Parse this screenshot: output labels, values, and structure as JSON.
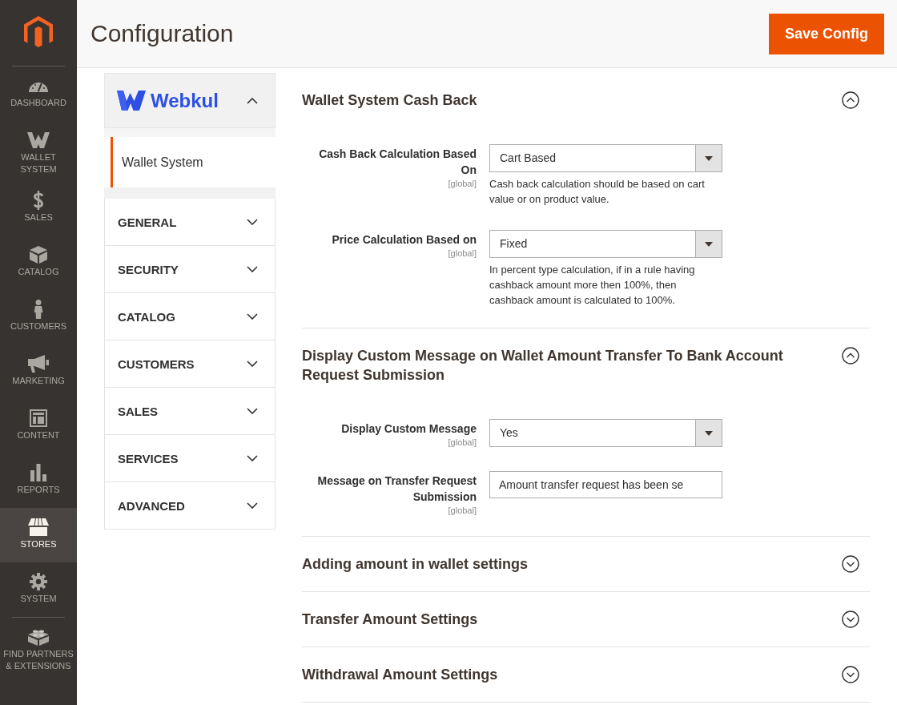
{
  "sidebar": {
    "items": [
      {
        "kind": "dashboard",
        "label": "DASHBOARD",
        "selected": false
      },
      {
        "kind": "wallet",
        "label": "WALLET SYSTEM",
        "selected": false
      },
      {
        "kind": "sales",
        "label": "SALES",
        "selected": false
      },
      {
        "kind": "catalog",
        "label": "CATALOG",
        "selected": false
      },
      {
        "kind": "customers",
        "label": "CUSTOMERS",
        "selected": false
      },
      {
        "kind": "marketing",
        "label": "MARKETING",
        "selected": false
      },
      {
        "kind": "content",
        "label": "CONTENT",
        "selected": false
      },
      {
        "kind": "reports",
        "label": "REPORTS",
        "selected": false
      },
      {
        "kind": "stores",
        "label": "STORES",
        "selected": true
      },
      {
        "kind": "system",
        "label": "SYSTEM",
        "selected": false
      },
      {
        "kind": "partners",
        "label": "FIND PARTNERS & EXTENSIONS",
        "selected": false
      }
    ]
  },
  "header": {
    "title": "Configuration",
    "save_button": "Save Config"
  },
  "config_tabs": {
    "brand": {
      "name": "Webkul",
      "expanded": true
    },
    "items": [
      {
        "label": "Wallet System",
        "selected": true
      }
    ],
    "groups": [
      {
        "label": "GENERAL",
        "expanded": false
      },
      {
        "label": "SECURITY",
        "expanded": false
      },
      {
        "label": "CATALOG",
        "expanded": false
      },
      {
        "label": "CUSTOMERS",
        "expanded": false
      },
      {
        "label": "SALES",
        "expanded": false
      },
      {
        "label": "SERVICES",
        "expanded": false
      },
      {
        "label": "ADVANCED",
        "expanded": false
      }
    ]
  },
  "sections": [
    {
      "title": "Wallet System Cash Back",
      "expanded": true,
      "fields": [
        {
          "kind": "select",
          "label": "Cash Back Calculation Based On",
          "scope": "[global]",
          "value": "Cart Based",
          "hint": "Cash back calculation should be based on cart value or on product value."
        },
        {
          "kind": "select",
          "label": "Price Calculation Based on",
          "scope": "[global]",
          "value": "Fixed",
          "hint": "In percent type calculation, if in a rule having cashback amount more then 100%, then cashback amount is calculated to 100%."
        }
      ]
    },
    {
      "title": "Display Custom Message on Wallet Amount Transfer To Bank Account Request Submission",
      "expanded": true,
      "fields": [
        {
          "kind": "select",
          "label": "Display Custom Message",
          "scope": "[global]",
          "value": "Yes"
        },
        {
          "kind": "text",
          "label": "Message on Transfer Request Submission",
          "scope": "[global]",
          "value": "Amount transfer request has been se"
        }
      ]
    },
    {
      "title": "Adding amount in wallet settings",
      "expanded": false
    },
    {
      "title": "Transfer Amount Settings",
      "expanded": false
    },
    {
      "title": "Withdrawal Amount Settings",
      "expanded": false
    }
  ]
}
